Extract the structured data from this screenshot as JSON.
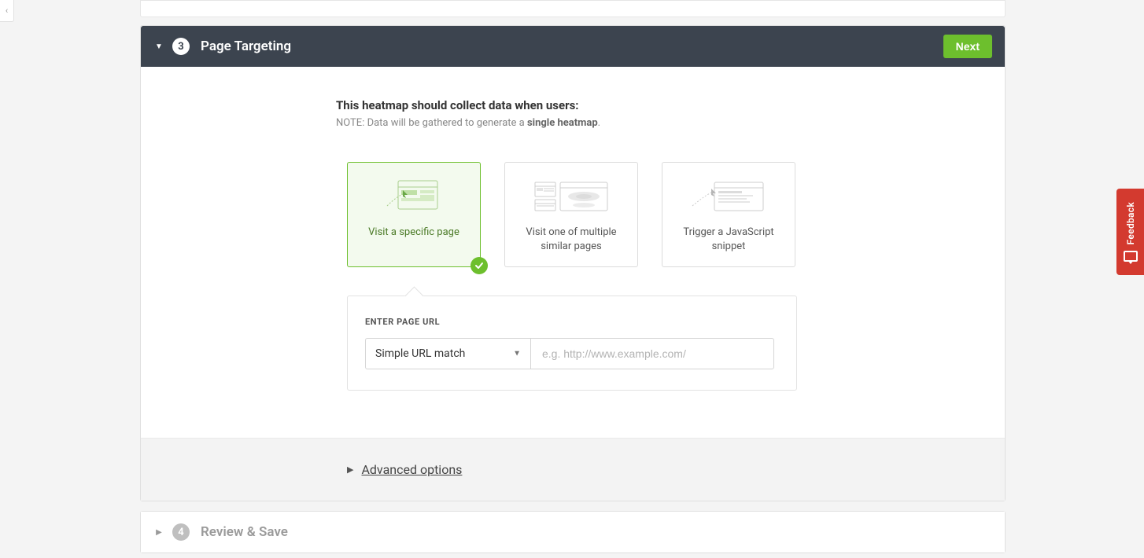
{
  "sidebar": {
    "toggle_glyph": "‹"
  },
  "step3": {
    "number": "3",
    "title": "Page Targeting",
    "next_label": "Next",
    "lead": "This heatmap should collect data when users:",
    "note_prefix": "NOTE: Data will be gathered to generate a ",
    "note_strong": "single heatmap",
    "note_suffix": ".",
    "cards": [
      {
        "label": "Visit a specific page",
        "selected": true
      },
      {
        "label": "Visit one of multiple similar pages",
        "selected": false
      },
      {
        "label": "Trigger a JavaScript snippet",
        "selected": false
      }
    ],
    "form": {
      "label": "ENTER PAGE URL",
      "select_value": "Simple URL match",
      "url_placeholder": "e.g. http://www.example.com/"
    },
    "advanced_label": "Advanced options"
  },
  "step4": {
    "number": "4",
    "title": "Review & Save"
  },
  "feedback": {
    "label": "Feedback"
  }
}
